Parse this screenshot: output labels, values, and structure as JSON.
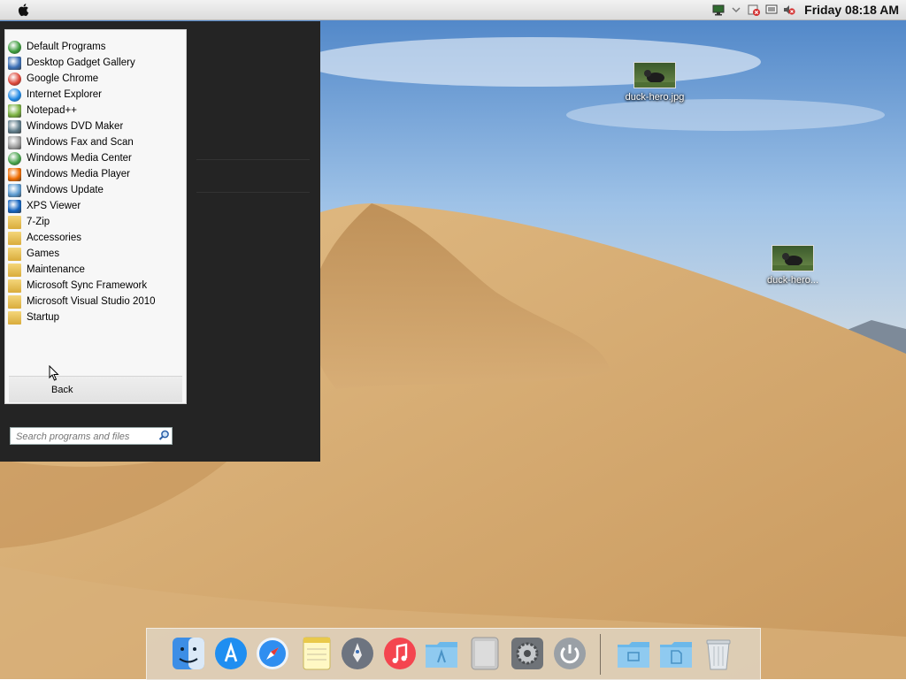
{
  "menubar": {
    "clock": "Friday 08:18 AM",
    "tray_icons": [
      "network-icon",
      "dropdown-arrow-icon",
      "security-alert-icon",
      "display-icon",
      "volume-muted-icon"
    ]
  },
  "desktop_icons": [
    {
      "label": "duck-hero.jpg"
    },
    {
      "label": "duck-hero..."
    }
  ],
  "start_menu": {
    "programs": [
      {
        "label": "Default Programs",
        "icon": "default-programs-icon",
        "color": "#3a9a3a"
      },
      {
        "label": "Desktop Gadget Gallery",
        "icon": "gadget-gallery-icon",
        "color": "#3b6fb6"
      },
      {
        "label": "Google Chrome",
        "icon": "chrome-icon",
        "color": "#db4437"
      },
      {
        "label": "Internet Explorer",
        "icon": "internet-explorer-icon",
        "color": "#1e88e5"
      },
      {
        "label": "Notepad++",
        "icon": "notepad-plus-plus-icon",
        "color": "#7cb342"
      },
      {
        "label": "Windows DVD Maker",
        "icon": "dvd-maker-icon",
        "color": "#607d8b"
      },
      {
        "label": "Windows Fax and Scan",
        "icon": "fax-scan-icon",
        "color": "#9e9e9e"
      },
      {
        "label": "Windows Media Center",
        "icon": "media-center-icon",
        "color": "#43a047"
      },
      {
        "label": "Windows Media Player",
        "icon": "media-player-icon",
        "color": "#ef6c00"
      },
      {
        "label": "Windows Update",
        "icon": "windows-update-icon",
        "color": "#5c9bd1"
      },
      {
        "label": "XPS Viewer",
        "icon": "xps-viewer-icon",
        "color": "#1565c0"
      },
      {
        "label": "7-Zip",
        "icon": "folder-icon",
        "color": "#e0b44a"
      },
      {
        "label": "Accessories",
        "icon": "folder-icon",
        "color": "#e0b44a"
      },
      {
        "label": "Games",
        "icon": "folder-icon",
        "color": "#e0b44a"
      },
      {
        "label": "Maintenance",
        "icon": "folder-icon",
        "color": "#e0b44a"
      },
      {
        "label": "Microsoft Sync Framework",
        "icon": "folder-icon",
        "color": "#e0b44a"
      },
      {
        "label": "Microsoft Visual Studio 2010",
        "icon": "folder-icon",
        "color": "#e0b44a"
      },
      {
        "label": "Startup",
        "icon": "folder-icon",
        "color": "#e0b44a"
      }
    ],
    "back_label": "Back",
    "search_placeholder": "Search programs and files"
  },
  "dock": {
    "items": [
      {
        "name": "finder-icon"
      },
      {
        "name": "app-store-icon"
      },
      {
        "name": "safari-icon"
      },
      {
        "name": "notes-icon"
      },
      {
        "name": "launchpad-icon"
      },
      {
        "name": "music-icon"
      },
      {
        "name": "applications-folder-icon"
      },
      {
        "name": "mac-pro-icon"
      },
      {
        "name": "system-preferences-icon"
      },
      {
        "name": "power-icon"
      },
      {
        "name": "documents-folder-icon"
      },
      {
        "name": "files-folder-icon"
      },
      {
        "name": "trash-icon"
      }
    ]
  }
}
